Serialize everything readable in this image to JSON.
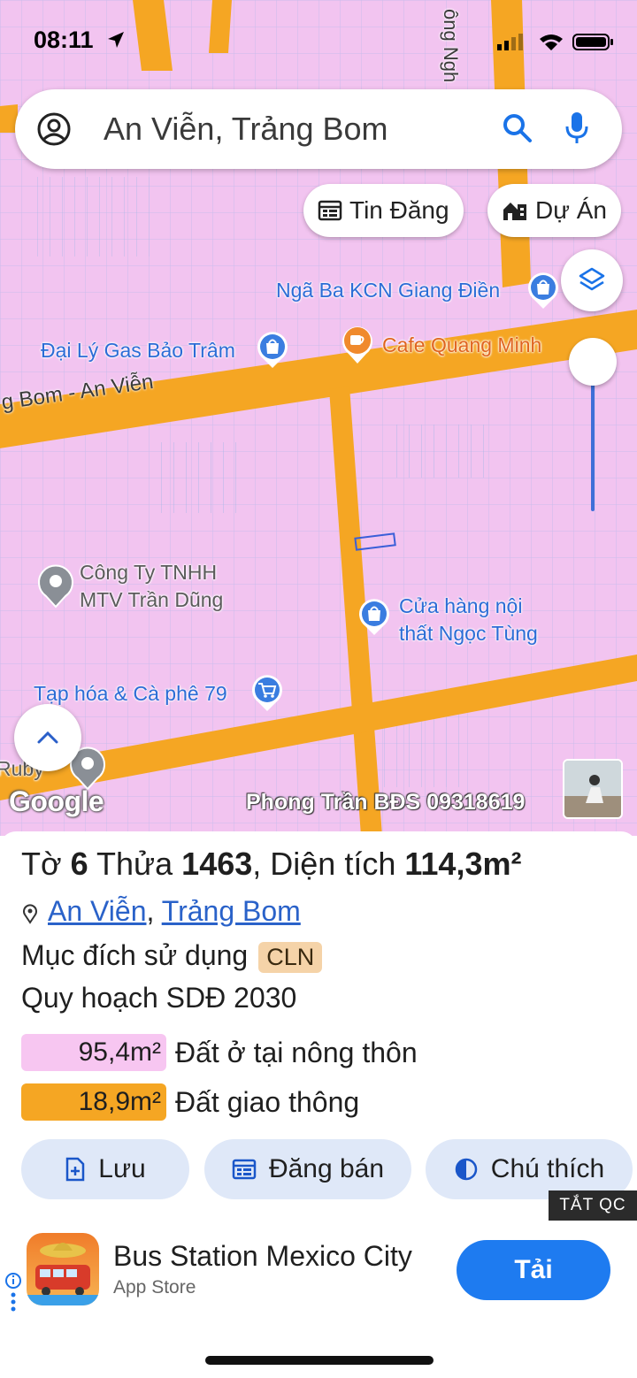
{
  "status_bar": {
    "time": "08:11",
    "location_icon": "location-arrow-icon",
    "signal_icon": "cellular-signal-icon",
    "wifi_icon": "wifi-icon",
    "battery_icon": "battery-icon"
  },
  "search": {
    "value": "An Viễn, Trảng Bom",
    "account_icon": "account-circle-icon",
    "search_icon": "search-icon",
    "mic_icon": "microphone-icon"
  },
  "chips": [
    {
      "label": "Tin Đăng",
      "icon": "calendar-list-icon"
    },
    {
      "label": "Dự Án",
      "icon": "building-icon"
    }
  ],
  "map": {
    "colors": {
      "land": "#f2c4f0",
      "road": "#f5a623",
      "parcel_line": "#9fb2e0"
    },
    "road_labels": [
      "g Bom - An Viễn",
      "ông Ngh"
    ],
    "pois": [
      {
        "label": "Ngã Ba KCN Giang Điền",
        "icon": "shopping-bag-pin-icon"
      },
      {
        "label": "Đại Lý Gas Bảo Trâm",
        "icon": "shopping-bag-pin-icon"
      },
      {
        "label": "Cafe Quang Minh",
        "icon": "coffee-pin-icon"
      },
      {
        "label_line1": "Công Ty TNHH",
        "label_line2": "MTV Trần Dũng",
        "icon": "gray-pin-icon"
      },
      {
        "label_line1": "Cửa hàng nội",
        "label_line2": "thất Ngọc Tùng",
        "icon": "shopping-bag-pin-icon"
      },
      {
        "label": "Tạp hóa & Cà phê 79",
        "icon": "shopping-cart-pin-icon"
      },
      {
        "label": "Ruby",
        "icon": "gray-pin-icon"
      }
    ],
    "google_logo": "Google",
    "watermark": "Phong Trần BĐS 09318619"
  },
  "parcel": {
    "to_label": "Tờ",
    "to_value": "6",
    "thua_label": "Thửa",
    "thua_value": "1463",
    "area_label": "Diện tích",
    "area_value": "114,3m²",
    "commune": "An Viễn",
    "district": "Trảng Bom",
    "location_sep": ",",
    "purpose_label": "Mục đích sử dụng",
    "purpose_code": "CLN",
    "plan_label": "Quy hoạch SDĐ 2030",
    "land_uses": [
      {
        "area": "95,4m²",
        "label": "Đất ở tại nông thôn",
        "color": "#f7c6f1"
      },
      {
        "area": "18,9m²",
        "label": "Đất giao thông",
        "color": "#f5a623"
      }
    ]
  },
  "actions": [
    {
      "label": "Lưu",
      "icon": "bookmark-add-icon"
    },
    {
      "label": "Đăng bán",
      "icon": "calendar-post-icon"
    },
    {
      "label": "Chú thích",
      "icon": "contrast-icon"
    }
  ],
  "ad": {
    "close_label": "TẮT QC",
    "title": "Bus Station Mexico City",
    "source": "App Store",
    "button": "Tải"
  }
}
